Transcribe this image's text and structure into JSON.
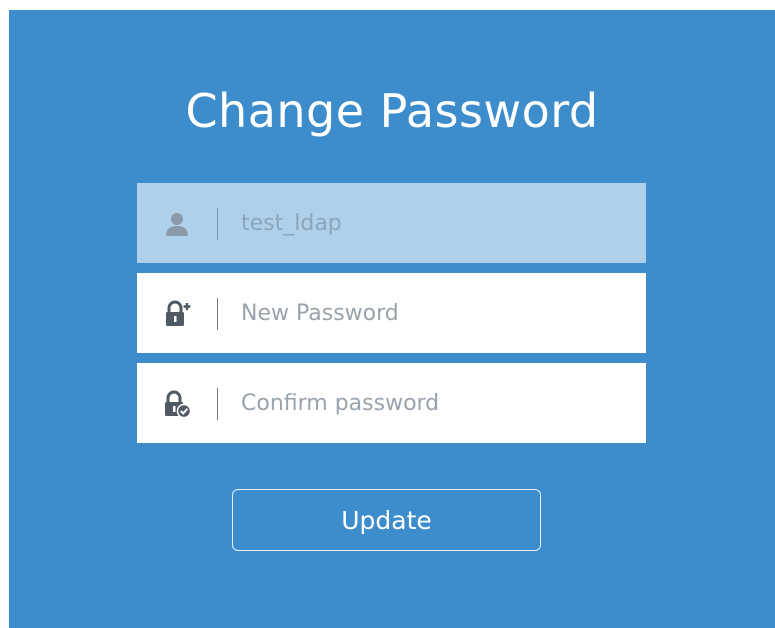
{
  "form": {
    "title": "Change Password",
    "username": {
      "value": "test_ldap",
      "icon": "user-icon"
    },
    "new_password": {
      "placeholder": "New Password",
      "icon": "lock-plus-icon"
    },
    "confirm_password": {
      "placeholder": "Confirm password",
      "icon": "lock-check-icon"
    },
    "submit_label": "Update"
  },
  "colors": {
    "background": "#3d8dcd",
    "readonly_field": "#afd0ea",
    "field": "#ffffff",
    "icon": "#505a64",
    "text_placeholder": "#9aa3ad"
  }
}
